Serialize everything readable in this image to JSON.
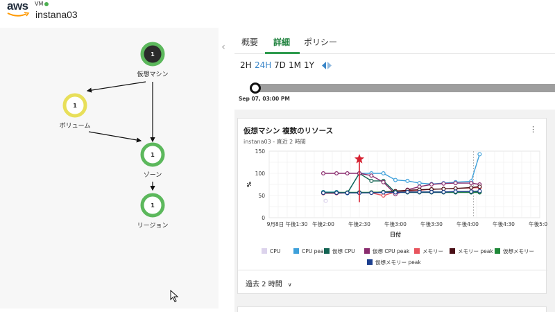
{
  "header": {
    "logo_text": "aws",
    "vm_tag": "VM",
    "app_title": "instana03"
  },
  "graph": {
    "nodes": [
      {
        "id": "vm",
        "label": "仮想マシン",
        "count": "1",
        "ring": "#5cb85c",
        "core": "#2b2b2b",
        "text": "#ffffff"
      },
      {
        "id": "volume",
        "label": "ボリューム",
        "count": "1",
        "ring": "#e8df5a",
        "core": "#ffffff",
        "text": "#222222"
      },
      {
        "id": "zone",
        "label": "ゾーン",
        "count": "1",
        "ring": "#5cb85c",
        "core": "#ffffff",
        "text": "#222222"
      },
      {
        "id": "region",
        "label": "リージョン",
        "count": "1",
        "ring": "#5cb85c",
        "core": "#ffffff",
        "text": "#222222"
      }
    ]
  },
  "tabs": [
    {
      "label": "概要",
      "active": false
    },
    {
      "label": "詳細",
      "active": true
    },
    {
      "label": "ポリシー",
      "active": false
    }
  ],
  "ranges": [
    {
      "label": "2H",
      "active": false
    },
    {
      "label": "24H",
      "active": true
    },
    {
      "label": "7D",
      "active": false
    },
    {
      "label": "1M",
      "active": false
    },
    {
      "label": "1Y",
      "active": false
    }
  ],
  "timeline": {
    "label": "Sep 07, 03:00 PM"
  },
  "card": {
    "title": "仮想マシン 複数のリソース",
    "subtitle": "instana03 - 直近 2 時間",
    "menu_icon": "kebab-icon",
    "footer_label": "過去 2 時間"
  },
  "colors": {
    "accent_green": "#2e9b4e",
    "active_range": "#3a86c8",
    "event_marker": "#d62030"
  },
  "chart_data": {
    "type": "line",
    "xlabel": "日付",
    "ylabel": "%",
    "ylim": [
      0,
      150
    ],
    "yticks": [
      "0",
      "50",
      "100",
      "150"
    ],
    "xlim_minutes": [
      75,
      300
    ],
    "xticks": [
      {
        "label": "9月8日 午後1:30",
        "m": 90
      },
      {
        "label": "午後2:00",
        "m": 120
      },
      {
        "label": "午後2:30",
        "m": 150
      },
      {
        "label": "午後3:00",
        "m": 180
      },
      {
        "label": "午後3:30",
        "m": 210
      },
      {
        "label": "午後4:00",
        "m": 240
      },
      {
        "label": "午後4:30",
        "m": 270
      },
      {
        "label": "午後5:00",
        "m": 300
      }
    ],
    "grid": true,
    "legend_position": "bottom",
    "event_marker_m": 150,
    "current_time_m": 245,
    "series": [
      {
        "name": "CPU",
        "color": "#dcd3ec",
        "points": [
          [
            122,
            38
          ]
        ]
      },
      {
        "name": "CPU peak",
        "color": "#3ea0da",
        "points": [
          [
            120,
            58
          ],
          [
            131,
            58
          ],
          [
            140,
            55
          ],
          [
            150,
            100
          ],
          [
            160,
            100
          ],
          [
            170,
            100
          ],
          [
            180,
            85
          ],
          [
            190,
            83
          ],
          [
            200,
            78
          ],
          [
            210,
            76
          ],
          [
            220,
            78
          ],
          [
            230,
            80
          ],
          [
            243,
            82
          ],
          [
            250,
            143
          ]
        ]
      },
      {
        "name": "仮想 CPU",
        "color": "#126352",
        "points": [
          [
            120,
            56
          ],
          [
            131,
            56
          ],
          [
            140,
            56
          ],
          [
            150,
            100
          ],
          [
            160,
            83
          ],
          [
            170,
            83
          ],
          [
            180,
            57
          ],
          [
            190,
            57
          ],
          [
            200,
            57
          ],
          [
            210,
            57
          ],
          [
            220,
            57
          ],
          [
            230,
            57
          ],
          [
            243,
            57
          ],
          [
            250,
            57
          ]
        ]
      },
      {
        "name": "仮想 CPU peak",
        "color": "#8a2c6e",
        "points": [
          [
            120,
            100
          ],
          [
            131,
            100
          ],
          [
            140,
            100
          ],
          [
            150,
            100
          ],
          [
            160,
            95
          ],
          [
            170,
            80
          ],
          [
            180,
            53
          ],
          [
            190,
            63
          ],
          [
            200,
            70
          ],
          [
            210,
            75
          ],
          [
            220,
            77
          ],
          [
            230,
            78
          ],
          [
            243,
            78
          ],
          [
            250,
            75
          ]
        ]
      },
      {
        "name": "メモリー",
        "color": "#e8545d",
        "points": [
          [
            120,
            55
          ],
          [
            131,
            55
          ],
          [
            140,
            56
          ],
          [
            150,
            57
          ],
          [
            160,
            56
          ],
          [
            170,
            50
          ],
          [
            180,
            58
          ],
          [
            190,
            60
          ],
          [
            200,
            62
          ],
          [
            210,
            64
          ],
          [
            220,
            65
          ],
          [
            230,
            66
          ],
          [
            243,
            67
          ],
          [
            250,
            68
          ]
        ]
      },
      {
        "name": "メモリー peak",
        "color": "#4a0f16",
        "points": [
          [
            120,
            56
          ],
          [
            131,
            56
          ],
          [
            140,
            56
          ],
          [
            150,
            56
          ],
          [
            160,
            57
          ],
          [
            170,
            58
          ],
          [
            180,
            60
          ],
          [
            190,
            62
          ],
          [
            200,
            63
          ],
          [
            210,
            64
          ],
          [
            220,
            65
          ],
          [
            230,
            66
          ],
          [
            243,
            68
          ],
          [
            250,
            70
          ]
        ]
      },
      {
        "name": "仮想メモリー",
        "color": "#1f8838",
        "points": [
          [
            120,
            57
          ],
          [
            131,
            57
          ],
          [
            140,
            57
          ],
          [
            150,
            57
          ],
          [
            160,
            57
          ],
          [
            170,
            58
          ],
          [
            180,
            58
          ],
          [
            190,
            58
          ],
          [
            200,
            58
          ],
          [
            210,
            58
          ],
          [
            220,
            58
          ],
          [
            230,
            58
          ],
          [
            243,
            58
          ],
          [
            250,
            58
          ]
        ]
      },
      {
        "name": "仮想メモリー peak",
        "color": "#1c3f8f",
        "points": [
          [
            120,
            56
          ],
          [
            131,
            56
          ],
          [
            140,
            56
          ],
          [
            150,
            56
          ],
          [
            160,
            56
          ],
          [
            170,
            57
          ],
          [
            180,
            57
          ],
          [
            190,
            58
          ],
          [
            200,
            58
          ],
          [
            210,
            58
          ],
          [
            220,
            58
          ],
          [
            230,
            59
          ],
          [
            243,
            59
          ],
          [
            250,
            60
          ]
        ]
      }
    ]
  }
}
